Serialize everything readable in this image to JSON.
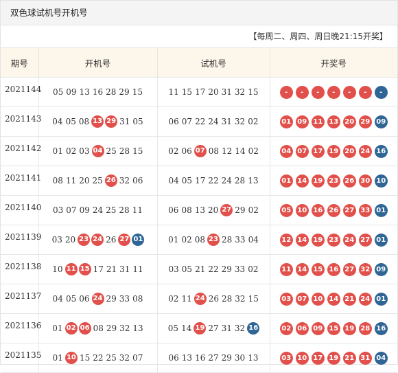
{
  "title": "双色球试机号开机号",
  "note": "【每周二、周四、周日晚21:15开奖】",
  "columns": [
    "期号",
    "开机号",
    "试机号",
    "开奖号"
  ],
  "colors": {
    "red": "#e2504b",
    "blue": "#2f6696"
  },
  "rows": [
    {
      "issue": "2021144",
      "kaiji": [
        [
          "05",
          "n"
        ],
        [
          "09",
          "n"
        ],
        [
          "13",
          "n"
        ],
        [
          "16",
          "n"
        ],
        [
          "28",
          "n"
        ],
        [
          "29",
          "n"
        ],
        [
          "15",
          "n"
        ]
      ],
      "shiji": [
        [
          "11",
          "n"
        ],
        [
          "15",
          "n"
        ],
        [
          "17",
          "n"
        ],
        [
          "20",
          "n"
        ],
        [
          "31",
          "n"
        ],
        [
          "32",
          "n"
        ],
        [
          "15",
          "n"
        ]
      ],
      "result": [
        [
          "-",
          "red"
        ],
        [
          "-",
          "red"
        ],
        [
          "-",
          "red"
        ],
        [
          "-",
          "red"
        ],
        [
          "-",
          "red"
        ],
        [
          "-",
          "red"
        ],
        [
          "-",
          "blue"
        ]
      ]
    },
    {
      "issue": "2021143",
      "kaiji": [
        [
          "04",
          "n"
        ],
        [
          "05",
          "n"
        ],
        [
          "08",
          "n"
        ],
        [
          "13",
          "red"
        ],
        [
          "29",
          "red"
        ],
        [
          "31",
          "n"
        ],
        [
          "05",
          "n"
        ]
      ],
      "shiji": [
        [
          "06",
          "n"
        ],
        [
          "07",
          "n"
        ],
        [
          "22",
          "n"
        ],
        [
          "24",
          "n"
        ],
        [
          "31",
          "n"
        ],
        [
          "32",
          "n"
        ],
        [
          "02",
          "n"
        ]
      ],
      "result": [
        [
          "01",
          "red"
        ],
        [
          "09",
          "red"
        ],
        [
          "11",
          "red"
        ],
        [
          "13",
          "red"
        ],
        [
          "20",
          "red"
        ],
        [
          "29",
          "red"
        ],
        [
          "09",
          "blue"
        ]
      ]
    },
    {
      "issue": "2021142",
      "kaiji": [
        [
          "01",
          "n"
        ],
        [
          "02",
          "n"
        ],
        [
          "03",
          "n"
        ],
        [
          "04",
          "red"
        ],
        [
          "25",
          "n"
        ],
        [
          "28",
          "n"
        ],
        [
          "15",
          "n"
        ]
      ],
      "shiji": [
        [
          "02",
          "n"
        ],
        [
          "06",
          "n"
        ],
        [
          "07",
          "red"
        ],
        [
          "08",
          "n"
        ],
        [
          "12",
          "n"
        ],
        [
          "14",
          "n"
        ],
        [
          "02",
          "n"
        ]
      ],
      "result": [
        [
          "04",
          "red"
        ],
        [
          "07",
          "red"
        ],
        [
          "17",
          "red"
        ],
        [
          "19",
          "red"
        ],
        [
          "20",
          "red"
        ],
        [
          "24",
          "red"
        ],
        [
          "16",
          "blue"
        ]
      ]
    },
    {
      "issue": "2021141",
      "kaiji": [
        [
          "08",
          "n"
        ],
        [
          "11",
          "n"
        ],
        [
          "20",
          "n"
        ],
        [
          "25",
          "n"
        ],
        [
          "26",
          "red"
        ],
        [
          "32",
          "n"
        ],
        [
          "06",
          "n"
        ]
      ],
      "shiji": [
        [
          "04",
          "n"
        ],
        [
          "05",
          "n"
        ],
        [
          "17",
          "n"
        ],
        [
          "22",
          "n"
        ],
        [
          "24",
          "n"
        ],
        [
          "28",
          "n"
        ],
        [
          "13",
          "n"
        ]
      ],
      "result": [
        [
          "01",
          "red"
        ],
        [
          "14",
          "red"
        ],
        [
          "19",
          "red"
        ],
        [
          "23",
          "red"
        ],
        [
          "26",
          "red"
        ],
        [
          "30",
          "red"
        ],
        [
          "10",
          "blue"
        ]
      ]
    },
    {
      "issue": "2021140",
      "kaiji": [
        [
          "03",
          "n"
        ],
        [
          "07",
          "n"
        ],
        [
          "09",
          "n"
        ],
        [
          "24",
          "n"
        ],
        [
          "25",
          "n"
        ],
        [
          "28",
          "n"
        ],
        [
          "11",
          "n"
        ]
      ],
      "shiji": [
        [
          "06",
          "n"
        ],
        [
          "08",
          "n"
        ],
        [
          "13",
          "n"
        ],
        [
          "20",
          "n"
        ],
        [
          "27",
          "red"
        ],
        [
          "29",
          "n"
        ],
        [
          "02",
          "n"
        ]
      ],
      "result": [
        [
          "05",
          "red"
        ],
        [
          "10",
          "red"
        ],
        [
          "16",
          "red"
        ],
        [
          "26",
          "red"
        ],
        [
          "27",
          "red"
        ],
        [
          "33",
          "red"
        ],
        [
          "01",
          "blue"
        ]
      ]
    },
    {
      "issue": "2021139",
      "kaiji": [
        [
          "03",
          "n"
        ],
        [
          "20",
          "n"
        ],
        [
          "23",
          "red"
        ],
        [
          "24",
          "red"
        ],
        [
          "26",
          "n"
        ],
        [
          "27",
          "red"
        ],
        [
          "01",
          "blue"
        ]
      ],
      "shiji": [
        [
          "01",
          "n"
        ],
        [
          "02",
          "n"
        ],
        [
          "08",
          "n"
        ],
        [
          "23",
          "red"
        ],
        [
          "28",
          "n"
        ],
        [
          "33",
          "n"
        ],
        [
          "04",
          "n"
        ]
      ],
      "result": [
        [
          "12",
          "red"
        ],
        [
          "14",
          "red"
        ],
        [
          "19",
          "red"
        ],
        [
          "23",
          "red"
        ],
        [
          "24",
          "red"
        ],
        [
          "27",
          "red"
        ],
        [
          "01",
          "blue"
        ]
      ]
    },
    {
      "issue": "2021138",
      "kaiji": [
        [
          "10",
          "n"
        ],
        [
          "11",
          "red"
        ],
        [
          "15",
          "red"
        ],
        [
          "17",
          "n"
        ],
        [
          "21",
          "n"
        ],
        [
          "31",
          "n"
        ],
        [
          "11",
          "n"
        ]
      ],
      "shiji": [
        [
          "03",
          "n"
        ],
        [
          "05",
          "n"
        ],
        [
          "21",
          "n"
        ],
        [
          "22",
          "n"
        ],
        [
          "29",
          "n"
        ],
        [
          "33",
          "n"
        ],
        [
          "02",
          "n"
        ]
      ],
      "result": [
        [
          "11",
          "red"
        ],
        [
          "14",
          "red"
        ],
        [
          "15",
          "red"
        ],
        [
          "16",
          "red"
        ],
        [
          "27",
          "red"
        ],
        [
          "32",
          "red"
        ],
        [
          "09",
          "blue"
        ]
      ]
    },
    {
      "issue": "2021137",
      "kaiji": [
        [
          "04",
          "n"
        ],
        [
          "05",
          "n"
        ],
        [
          "06",
          "n"
        ],
        [
          "24",
          "red"
        ],
        [
          "29",
          "n"
        ],
        [
          "33",
          "n"
        ],
        [
          "08",
          "n"
        ]
      ],
      "shiji": [
        [
          "02",
          "n"
        ],
        [
          "11",
          "n"
        ],
        [
          "24",
          "red"
        ],
        [
          "26",
          "n"
        ],
        [
          "28",
          "n"
        ],
        [
          "32",
          "n"
        ],
        [
          "15",
          "n"
        ]
      ],
      "result": [
        [
          "03",
          "red"
        ],
        [
          "07",
          "red"
        ],
        [
          "10",
          "red"
        ],
        [
          "14",
          "red"
        ],
        [
          "21",
          "red"
        ],
        [
          "24",
          "red"
        ],
        [
          "01",
          "blue"
        ]
      ]
    },
    {
      "issue": "2021136",
      "kaiji": [
        [
          "01",
          "n"
        ],
        [
          "02",
          "red"
        ],
        [
          "06",
          "red"
        ],
        [
          "08",
          "n"
        ],
        [
          "29",
          "n"
        ],
        [
          "32",
          "n"
        ],
        [
          "13",
          "n"
        ]
      ],
      "shiji": [
        [
          "05",
          "n"
        ],
        [
          "14",
          "n"
        ],
        [
          "19",
          "red"
        ],
        [
          "27",
          "n"
        ],
        [
          "31",
          "n"
        ],
        [
          "32",
          "n"
        ],
        [
          "16",
          "blue"
        ]
      ],
      "result": [
        [
          "02",
          "red"
        ],
        [
          "06",
          "red"
        ],
        [
          "09",
          "red"
        ],
        [
          "15",
          "red"
        ],
        [
          "19",
          "red"
        ],
        [
          "28",
          "red"
        ],
        [
          "16",
          "blue"
        ]
      ]
    },
    {
      "issue": "2021135",
      "kaiji": [
        [
          "01",
          "n"
        ],
        [
          "10",
          "red"
        ],
        [
          "15",
          "n"
        ],
        [
          "22",
          "n"
        ],
        [
          "25",
          "n"
        ],
        [
          "32",
          "n"
        ],
        [
          "07",
          "n"
        ]
      ],
      "shiji": [
        [
          "06",
          "n"
        ],
        [
          "13",
          "n"
        ],
        [
          "16",
          "n"
        ],
        [
          "27",
          "n"
        ],
        [
          "29",
          "n"
        ],
        [
          "30",
          "n"
        ],
        [
          "13",
          "n"
        ]
      ],
      "result": [
        [
          "03",
          "red"
        ],
        [
          "10",
          "red"
        ],
        [
          "17",
          "red"
        ],
        [
          "19",
          "red"
        ],
        [
          "21",
          "red"
        ],
        [
          "31",
          "red"
        ],
        [
          "04",
          "blue"
        ]
      ]
    }
  ]
}
